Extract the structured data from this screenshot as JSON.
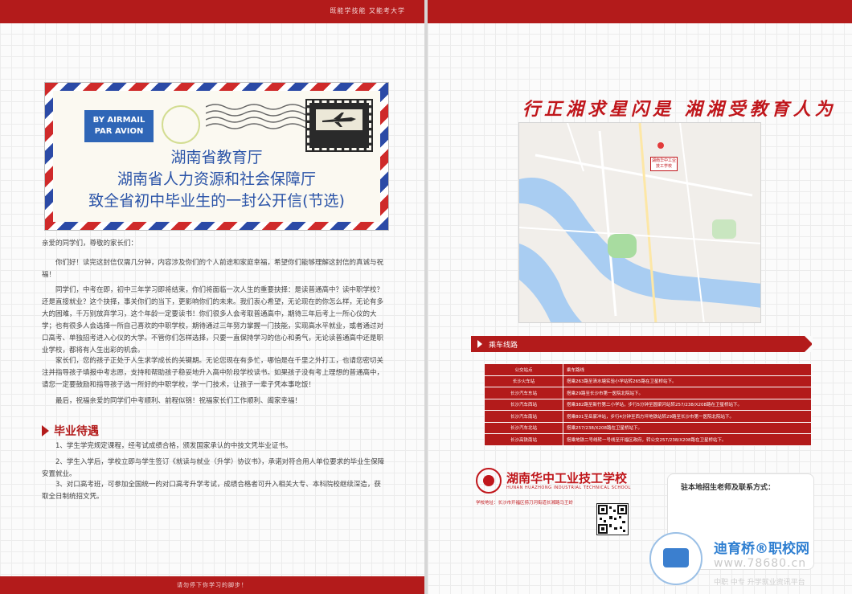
{
  "left_page": {
    "header": "既能学技能 又能考大学",
    "footer": "请勿停下你学习的脚步！",
    "envelope": {
      "airmail_line1": "BY AIRMAIL",
      "airmail_line2": "PAR AVION",
      "title_line1": "湖南省教育厅",
      "title_line2": "湖南省人力资源和社会保障厅",
      "title_line3": "致全省初中毕业生的一封公开信(节选)"
    },
    "letter": {
      "greeting": "亲爱的同学们，尊敬的家长们：",
      "p1": "你们好！读完这封信仅需几分钟，内容涉及你们的个人前途和家庭幸福，希望你们能够理解这封信的真诚与祝福！",
      "p2": "同学们，中考在即，初中三年学习即将结束，你们将面临一次人生的重要抉择：是读普通高中？读中职学校？还是直接就业？这个抉择，事关你们的当下，更影响你们的未来。我们衷心希望，无论现在的你怎么样，无论有多大的困难，千万别放弃学习，这个年龄一定要读书！你们很多人会考取普通高中，期待三年后考上一所心仪的大学；也有很多人会选择一所自己喜欢的中职学校，期待通过三年努力掌握一门技能，实现高水平就业，或者通过对口高考、单独招考进入心仪的大学。不管你们怎样选择，只要一直保持学习的信心和勇气，无论读普通高中还是职业学校，都将有人生出彩的机会。",
      "p3": "家长们，您的孩子正处于人生求学成长的关键期。无论您现在有多忙，哪怕是在千里之外打工，也请您密切关注并指导孩子填报中考志愿，支持和帮助孩子稳妥地升入高中阶段学校读书。如果孩子没有考上理想的普通高中，请您一定要鼓励和指导孩子选一所好的中职学校，学一门技术，让孩子一辈子凭本事吃饭！",
      "p4": "最后，祝福亲爱的同学们中考顺利、前程似锦！祝福家长们工作顺利、阖家幸福！"
    },
    "benefits": {
      "title": "毕业待遇",
      "item1": "1、学生学完规定课程，经考试成绩合格，颁发国家承认的中技文凭毕业证书。",
      "item2": "2、学生入学后，学校立即与学生签订《就读与就业（升学）协议书》，承诺对符合用人单位要求的毕业生保障安置就业。",
      "item3": "3、对口高考班，可参加全国统一的对口高考升学考试，成绩合格者可升入相关大专、本科院校继续深造，获取全日制统招文凭。"
    }
  },
  "right_page": {
    "slogan": "行正湘求星闪是 湘湘受教育人为",
    "map_label": "湖南华中工业技工学校",
    "route_section_title": "乘车线路",
    "route_table": {
      "headers": [
        "公交站点",
        "乘车路线"
      ],
      "rows": [
        [
          "长沙火车站",
          "搭乘263路至清水塘实验小学站转265路在卫星桥站下。"
        ],
        [
          "长沙汽车东站",
          "搭乘29路至长沙市第一医院北院站下。"
        ],
        [
          "长沙汽车西站",
          "搭乘382路至新竹第二小学站，步行5分钟至圆梁河站转257/238/X208路在卫星桥站下。"
        ],
        [
          "长沙汽车南站",
          "搭乘801至岳家冲站，步行4分钟至西方坪地铁站转29路至长沙市第一医院北院站下。"
        ],
        [
          "长沙汽车北站",
          "搭乘257/238/X208路在卫星桥站下。"
        ],
        [
          "长沙高铁南站",
          "搭乘地铁二号线转一号线至开福区政府，转公交257/238/X208路在卫星桥站下。"
        ]
      ]
    },
    "school": {
      "name_cn": "湖南华中工业技工学校",
      "name_en": "HUNAN HUAZHONG INDUSTRIAL TECHNICAL SCHOOL",
      "address": "学校地址：长沙市开福区捞刀河街道长湘路马王岭"
    },
    "contact_title": "驻本地招生老师及联系方式：",
    "watermark": {
      "title": "迪育桥®职校网",
      "url": "www.78680.cn",
      "subtitle": "中职 中专 升学就业资讯平台"
    }
  }
}
